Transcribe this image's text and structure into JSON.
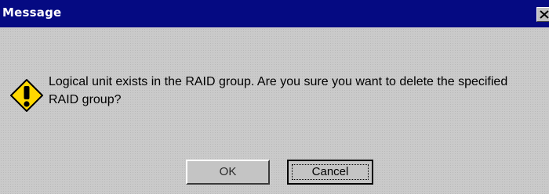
{
  "window": {
    "title": "Message",
    "title_bar_color": "#050a82"
  },
  "icons": {
    "close": "close-icon",
    "warning": "warning-exclamation-icon"
  },
  "dialog": {
    "message": "Logical unit exists in the RAID group. Are you sure you want to delete the specified RAID group?"
  },
  "buttons": {
    "ok_label": "OK",
    "cancel_label": "Cancel"
  }
}
